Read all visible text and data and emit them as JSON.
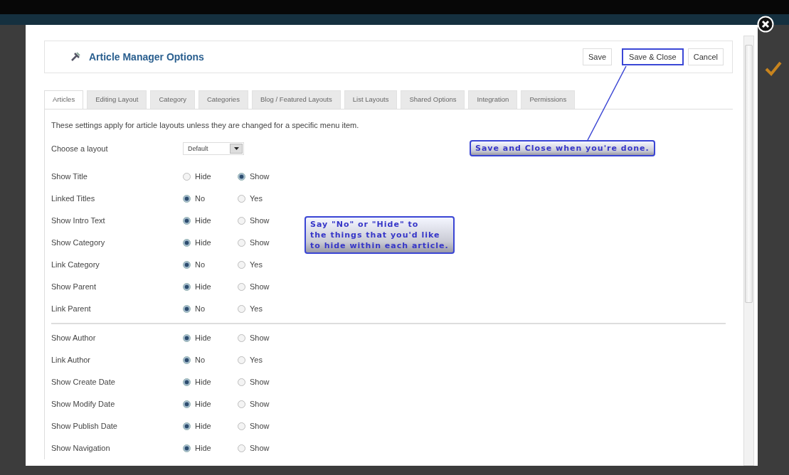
{
  "dialog": {
    "title": "Article Manager Options",
    "buttons": [
      {
        "label": "Save",
        "highlighted": false
      },
      {
        "label": "Save & Close",
        "highlighted": true
      },
      {
        "label": "Cancel",
        "highlighted": false
      }
    ]
  },
  "tabs": [
    {
      "label": "Articles",
      "selected": true
    },
    {
      "label": "Editing Layout",
      "selected": false
    },
    {
      "label": "Category",
      "selected": false
    },
    {
      "label": "Categories",
      "selected": false
    },
    {
      "label": "Blog / Featured Layouts",
      "selected": false
    },
    {
      "label": "List Layouts",
      "selected": false
    },
    {
      "label": "Shared Options",
      "selected": false
    },
    {
      "label": "Integration",
      "selected": false
    },
    {
      "label": "Permissions",
      "selected": false
    }
  ],
  "intro": "These settings apply for article layouts unless they are changed for a specific menu item.",
  "layout_field": {
    "label": "Choose a layout",
    "value": "Default"
  },
  "groups": [
    [
      {
        "label": "Show Title",
        "options": [
          {
            "label": "Hide",
            "selected": false
          },
          {
            "label": "Show",
            "selected": true
          }
        ]
      },
      {
        "label": "Linked Titles",
        "options": [
          {
            "label": "No",
            "selected": true
          },
          {
            "label": "Yes",
            "selected": false
          }
        ]
      },
      {
        "label": "Show Intro Text",
        "options": [
          {
            "label": "Hide",
            "selected": true
          },
          {
            "label": "Show",
            "selected": false
          }
        ]
      },
      {
        "label": "Show Category",
        "options": [
          {
            "label": "Hide",
            "selected": true
          },
          {
            "label": "Show",
            "selected": false
          }
        ]
      },
      {
        "label": "Link Category",
        "options": [
          {
            "label": "No",
            "selected": true
          },
          {
            "label": "Yes",
            "selected": false
          }
        ]
      },
      {
        "label": "Show Parent",
        "options": [
          {
            "label": "Hide",
            "selected": true
          },
          {
            "label": "Show",
            "selected": false
          }
        ]
      },
      {
        "label": "Link Parent",
        "options": [
          {
            "label": "No",
            "selected": true
          },
          {
            "label": "Yes",
            "selected": false
          }
        ]
      }
    ],
    [
      {
        "label": "Show Author",
        "options": [
          {
            "label": "Hide",
            "selected": true
          },
          {
            "label": "Show",
            "selected": false
          }
        ]
      },
      {
        "label": "Link Author",
        "options": [
          {
            "label": "No",
            "selected": true
          },
          {
            "label": "Yes",
            "selected": false
          }
        ]
      },
      {
        "label": "Show Create Date",
        "options": [
          {
            "label": "Hide",
            "selected": true
          },
          {
            "label": "Show",
            "selected": false
          }
        ]
      },
      {
        "label": "Show Modify Date",
        "options": [
          {
            "label": "Hide",
            "selected": true
          },
          {
            "label": "Show",
            "selected": false
          }
        ]
      },
      {
        "label": "Show Publish Date",
        "options": [
          {
            "label": "Hide",
            "selected": true
          },
          {
            "label": "Show",
            "selected": false
          }
        ]
      },
      {
        "label": "Show Navigation",
        "options": [
          {
            "label": "Hide",
            "selected": true
          },
          {
            "label": "Show",
            "selected": false
          }
        ]
      }
    ]
  ],
  "annotations": [
    {
      "lines": [
        "Save and Close when you're done."
      ],
      "pointer": true
    },
    {
      "lines": [
        "Say \"No\" or \"Hide\" to",
        "the things that you'd like",
        "to hide within each article."
      ],
      "pointer": false
    }
  ]
}
